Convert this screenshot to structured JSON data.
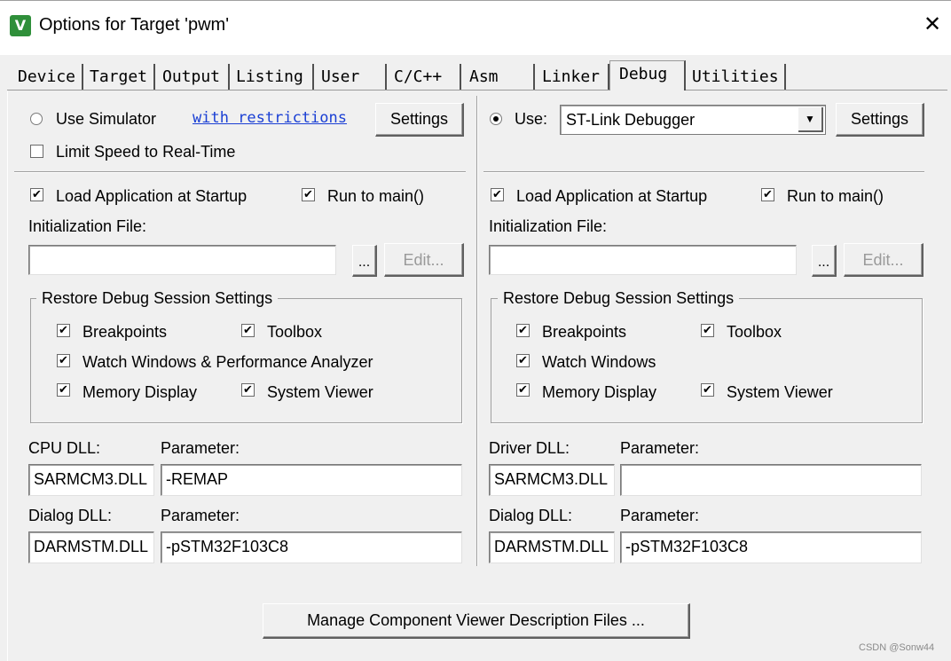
{
  "window": {
    "title": "Options for Target 'pwm'",
    "close_glyph": "✕",
    "icon_text": "V"
  },
  "tabs": [
    "Device",
    "Target",
    "Output",
    "Listing",
    "User",
    "C/C++",
    "Asm",
    "Linker",
    "Debug",
    "Utilities"
  ],
  "active_tab": "Debug",
  "left": {
    "use_simulator": "Use Simulator",
    "restrictions_link": "with restrictions",
    "settings": "Settings",
    "limit_speed": "Limit Speed to Real-Time",
    "load_app": "Load Application at Startup",
    "run_main": "Run to main()",
    "init_file_label": "Initialization File:",
    "init_file_value": "",
    "browse": "...",
    "edit": "Edit...",
    "restore_group": "Restore Debug Session Settings",
    "breakpoints": "Breakpoints",
    "toolbox": "Toolbox",
    "watch": "Watch Windows & Performance Analyzer",
    "memory": "Memory Display",
    "system_viewer": "System Viewer",
    "cpu_dll_label": "CPU DLL:",
    "param_label": "Parameter:",
    "cpu_dll": "SARMCM3.DLL",
    "cpu_param": "-REMAP",
    "dialog_dll_label": "Dialog DLL:",
    "dialog_dll": "DARMSTM.DLL",
    "dialog_param": "-pSTM32F103C8"
  },
  "right": {
    "use": "Use:",
    "debugger": "ST-Link Debugger",
    "settings": "Settings",
    "load_app": "Load Application at Startup",
    "run_main": "Run to main()",
    "init_file_label": "Initialization File:",
    "init_file_value": "",
    "browse": "...",
    "edit": "Edit...",
    "restore_group": "Restore Debug Session Settings",
    "breakpoints": "Breakpoints",
    "toolbox": "Toolbox",
    "watch": "Watch Windows",
    "memory": "Memory Display",
    "system_viewer": "System Viewer",
    "driver_dll_label": "Driver DLL:",
    "param_label": "Parameter:",
    "driver_dll": "SARMCM3.DLL",
    "driver_param": "",
    "dialog_dll_label": "Dialog DLL:",
    "dialog_dll": "DARMSTM.DLL",
    "dialog_param": "-pSTM32F103C8"
  },
  "manage_button": "Manage Component Viewer Description Files ...",
  "check_glyph": "✔",
  "watermark": "CSDN @Sonw44"
}
